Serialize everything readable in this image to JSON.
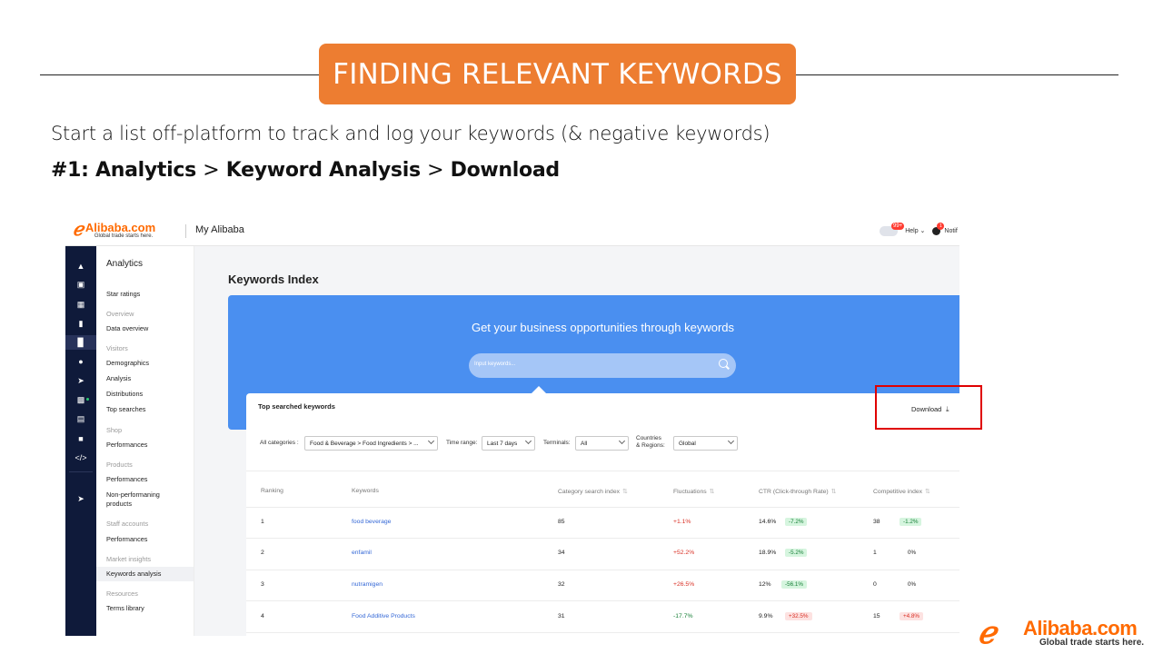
{
  "slide": {
    "title": "FINDING RELEVANT KEYWORDS",
    "subtitle": "Start a list off-platform to track and log your keywords (& negative keywords)",
    "step_prefix": "#1: Analytics",
    "step_mid": "Keyword Analysis",
    "step_end": "Download",
    "step_sep": ">",
    "accent_color": "#ed7d31"
  },
  "app": {
    "logo_name": "Alibaba.com",
    "logo_tagline": "Global trade starts here.",
    "section_title": "My Alibaba",
    "help_badge": "99+",
    "help_label": "Help",
    "notif_badge": "1",
    "notif_label": "Notif"
  },
  "iconbar": {
    "icons": [
      "home-icon",
      "store-icon",
      "grid-icon",
      "message-icon",
      "analytics-icon",
      "users-icon",
      "logistics-icon",
      "orders-icon",
      "bank-icon",
      "briefcase-icon",
      "code-icon",
      "send-icon"
    ]
  },
  "sidebar": {
    "title": "Analytics",
    "star_ratings": "Star ratings",
    "sec_overview": "Overview",
    "data_overview": "Data overview",
    "sec_visitors": "Visitors",
    "demographics": "Demographics",
    "analysis": "Analysis",
    "distributions": "Distributions",
    "top_searches": "Top searches",
    "sec_shop": "Shop",
    "shop_performances": "Performances",
    "sec_products": "Products",
    "products_performances": "Performances",
    "non_performing": "Non-performaning products",
    "sec_staff": "Staff accounts",
    "staff_performances": "Performances",
    "sec_market": "Market insights",
    "keywords_analysis": "Keywords analysis",
    "sec_resources": "Resources",
    "terms_library": "Terms library"
  },
  "main": {
    "page_title": "Keywords Index",
    "hero_text": "Get your business opportunities through keywords",
    "search_placeholder": "Input keywords...",
    "panel_title": "Top searched keywords",
    "download_label": "Download",
    "filters": {
      "categories_label": "All categories :",
      "categories_value": "Food & Beverage > Food Ingredients > ...",
      "time_label": "Time range:",
      "time_value": "Last 7 days",
      "terminals_label": "Terminals:",
      "terminals_value": "All",
      "countries_label_1": "Countries",
      "countries_label_2": "& Regions:",
      "countries_value": "Global"
    },
    "table": {
      "headers": [
        "Ranking",
        "Keywords",
        "Category search index",
        "Fluctuations",
        "CTR (Click-through Rate)",
        "Competitive index"
      ],
      "rows": [
        {
          "rank": "1",
          "keyword": "food beverage",
          "index": "85",
          "fluct": "+1.1%",
          "ctr": "14.6%",
          "ctr_change": "-7.2%",
          "comp": "38",
          "comp_change": "-1.2%"
        },
        {
          "rank": "2",
          "keyword": "enfamil",
          "index": "34",
          "fluct": "+52.2%",
          "ctr": "18.9%",
          "ctr_change": "-5.2%",
          "comp": "1",
          "comp_change": "0%"
        },
        {
          "rank": "3",
          "keyword": "nutramigen",
          "index": "32",
          "fluct": "+26.5%",
          "ctr": "12%",
          "ctr_change": "-56.1%",
          "comp": "0",
          "comp_change": "0%"
        },
        {
          "rank": "4",
          "keyword": "Food Additive Products",
          "index": "31",
          "fluct": "-17.7%",
          "ctr": "9.9%",
          "ctr_change": "+32.5%",
          "comp": "15",
          "comp_change": "+4.8%"
        }
      ]
    }
  }
}
